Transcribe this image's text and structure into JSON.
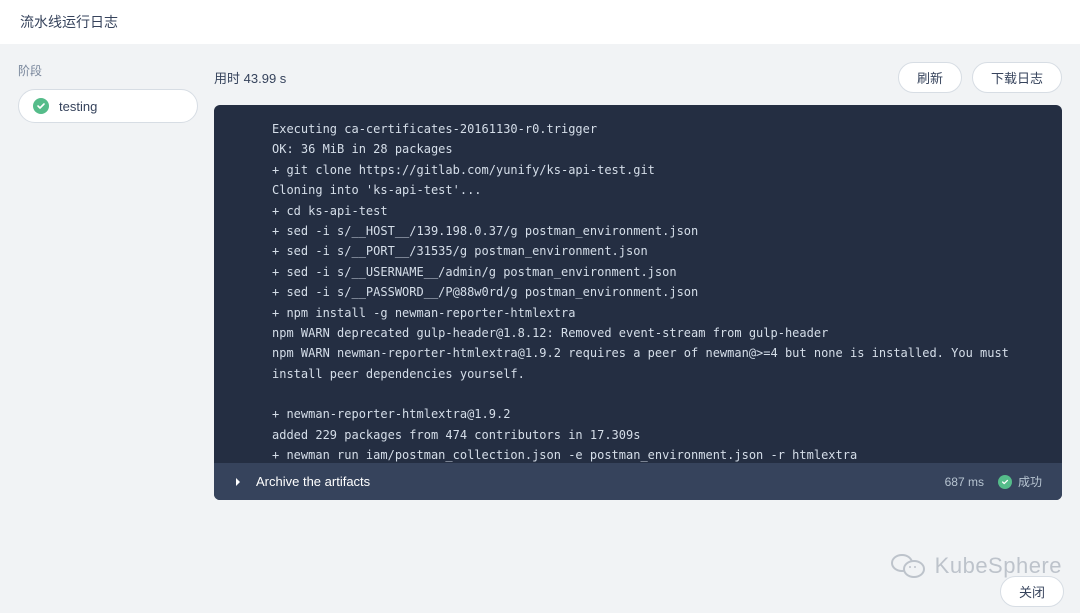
{
  "header": {
    "title": "流水线运行日志"
  },
  "sidebar": {
    "label": "阶段",
    "stage": {
      "name": "testing",
      "status": "success"
    }
  },
  "content": {
    "duration_label": "用时",
    "duration_value": "43.99 s",
    "refresh_label": "刷新",
    "download_label": "下载日志"
  },
  "log": {
    "lines": [
      "Executing ca-certificates-20161130-r0.trigger",
      "OK: 36 MiB in 28 packages",
      "+ git clone https://gitlab.com/yunify/ks-api-test.git",
      "Cloning into 'ks-api-test'...",
      "+ cd ks-api-test",
      "+ sed -i s/__HOST__/139.198.0.37/g postman_environment.json",
      "+ sed -i s/__PORT__/31535/g postman_environment.json",
      "+ sed -i s/__USERNAME__/admin/g postman_environment.json",
      "+ sed -i s/__PASSWORD__/P@88w0rd/g postman_environment.json",
      "+ npm install -g newman-reporter-htmlextra",
      "npm WARN deprecated gulp-header@1.8.12: Removed event-stream from gulp-header",
      "npm WARN newman-reporter-htmlextra@1.9.2 requires a peer of newman@>=4 but none is installed. You must install peer dependencies yourself.",
      "",
      "+ newman-reporter-htmlextra@1.9.2",
      "added 229 packages from 474 contributors in 17.309s",
      "+ newman run iam/postman_collection.json -e postman_environment.json -r htmlextra"
    ],
    "step": {
      "name": "Archive the artifacts",
      "duration": "687 ms",
      "status_label": "成功"
    }
  },
  "watermark": {
    "text": "KubeSphere"
  },
  "footer": {
    "close_label": "关闭"
  }
}
